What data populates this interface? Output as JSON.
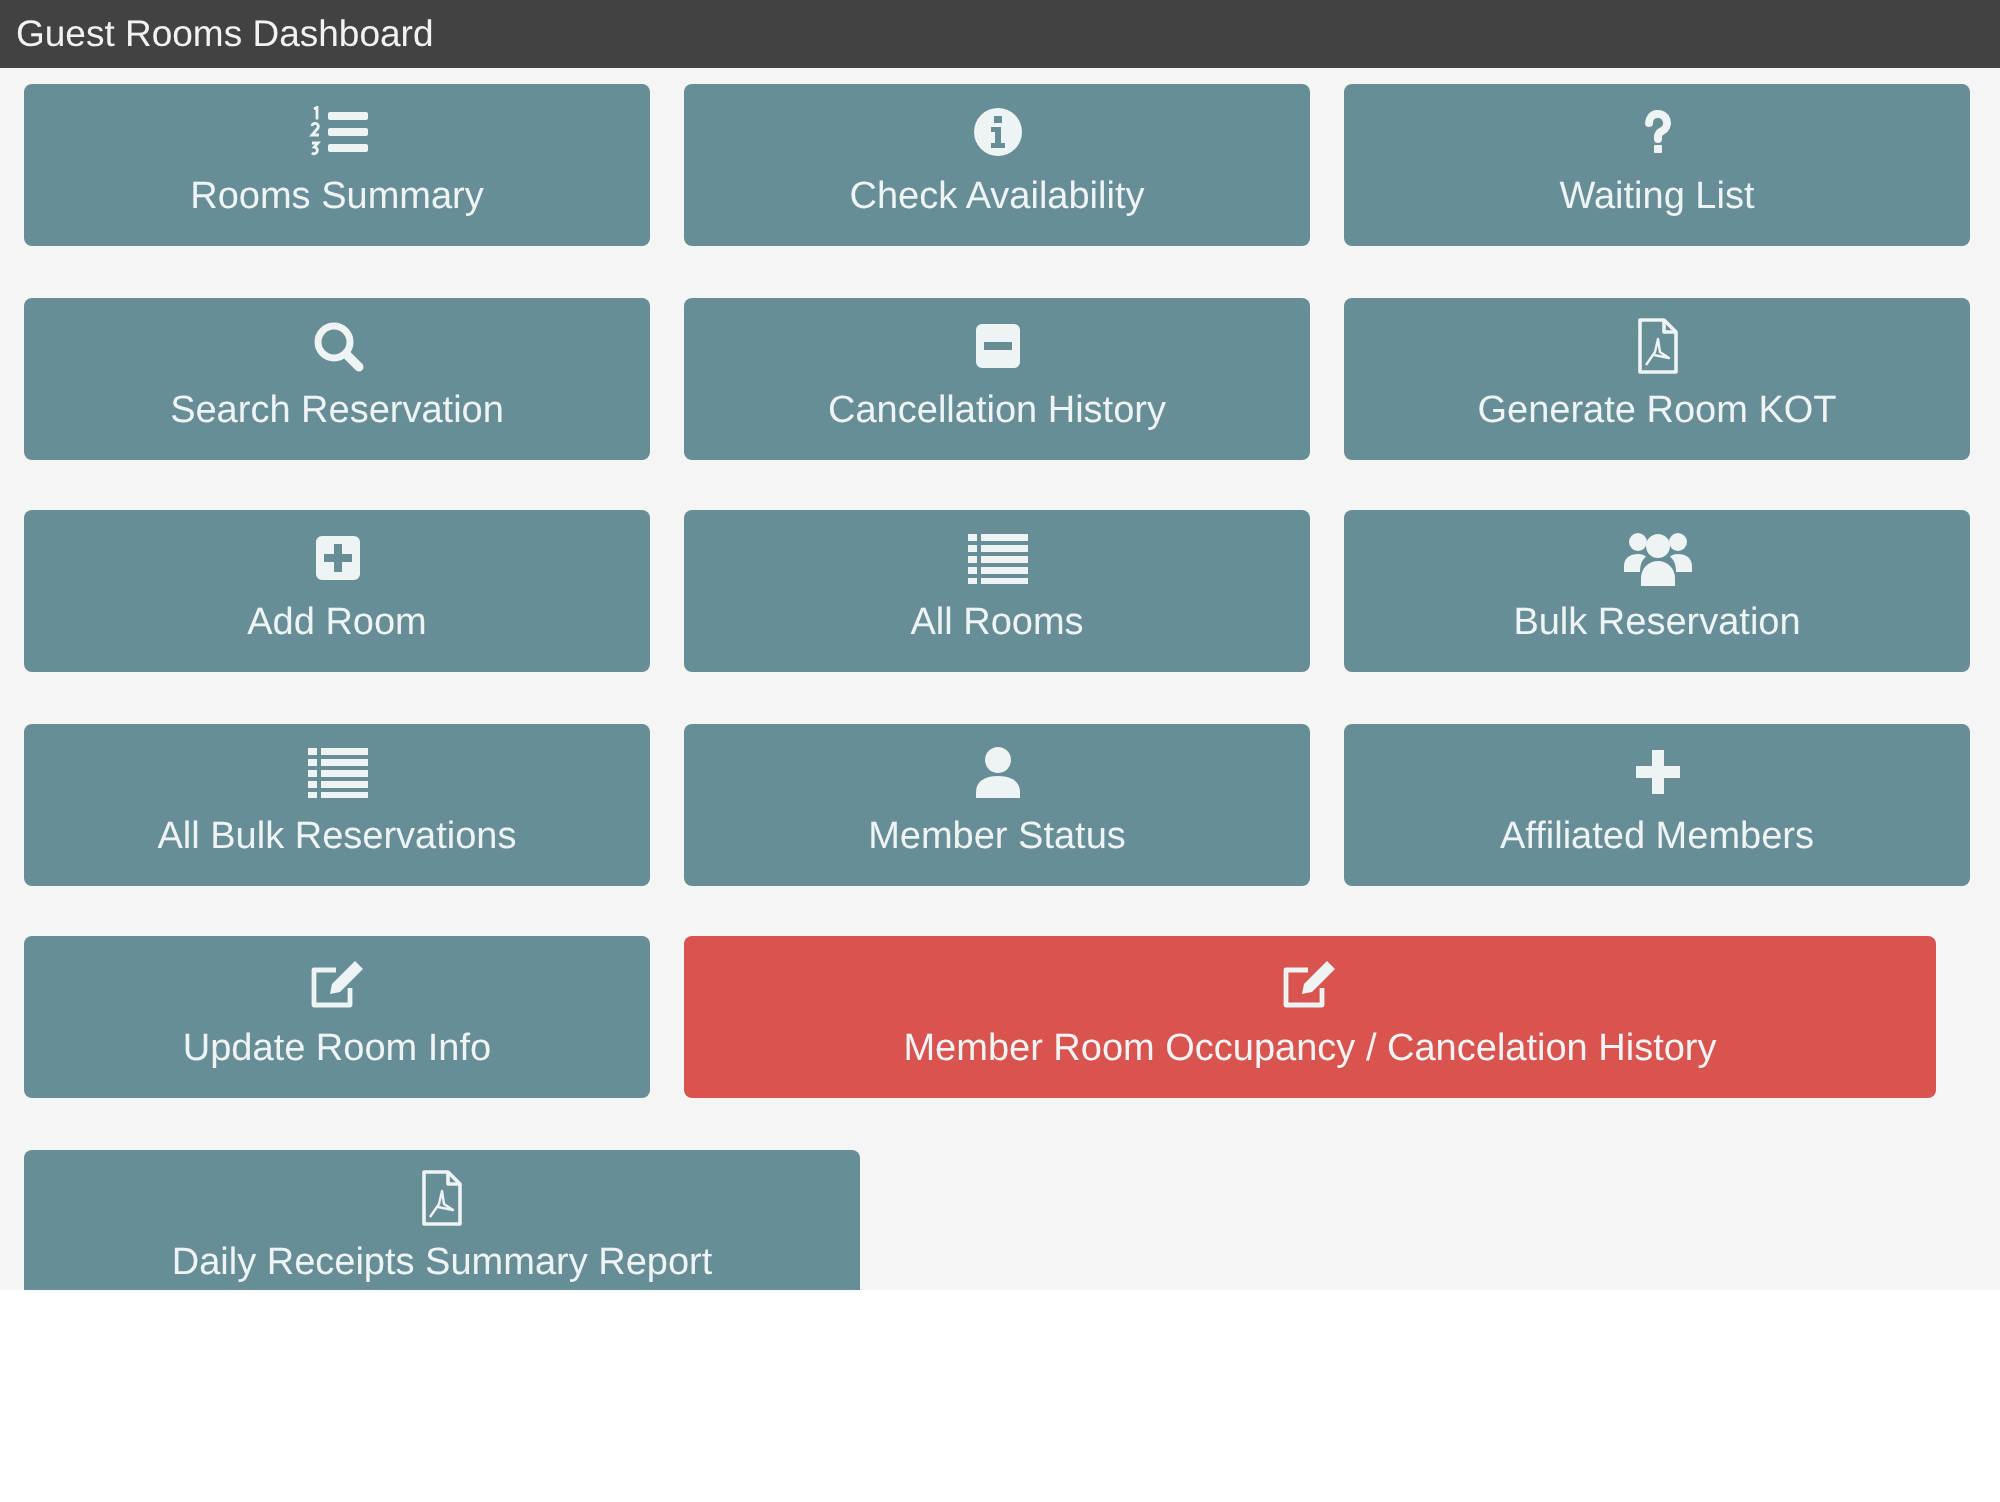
{
  "header": {
    "title": "Guest Rooms Dashboard"
  },
  "tiles": [
    {
      "label": "Rooms Summary",
      "color": "#678d96"
    },
    {
      "label": "Check Availability",
      "color": "#678d96"
    },
    {
      "label": "Waiting List",
      "color": "#678d96"
    },
    {
      "label": "Search Reservation",
      "color": "#678d96"
    },
    {
      "label": "Cancellation History",
      "color": "#678d96"
    },
    {
      "label": "Generate Room KOT",
      "color": "#678d96"
    },
    {
      "label": "Add Room",
      "color": "#678d96"
    },
    {
      "label": "All Rooms",
      "color": "#678d96"
    },
    {
      "label": "Bulk Reservation",
      "color": "#678d96"
    },
    {
      "label": "All Bulk Reservations",
      "color": "#678d96"
    },
    {
      "label": "Member Status",
      "color": "#678d96"
    },
    {
      "label": "Affiliated Members",
      "color": "#678d96"
    },
    {
      "label": "Update Room Info",
      "color": "#678d96"
    },
    {
      "label": "Member Room Occupancy / Cancelation History",
      "color": "#d9534f"
    },
    {
      "label": "Daily Receipts Summary Report",
      "color": "#678d96"
    }
  ]
}
